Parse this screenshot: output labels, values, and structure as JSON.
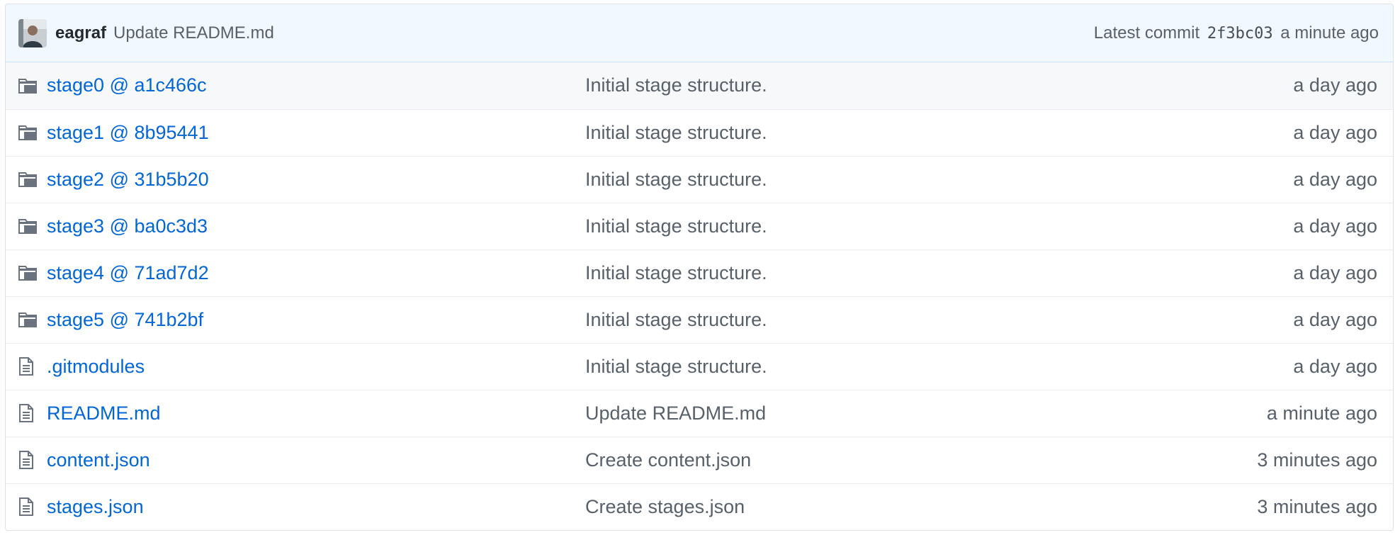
{
  "latest_commit": {
    "author": "eagraf",
    "message": "Update README.md",
    "prefix": "Latest commit",
    "sha": "2f3bc03",
    "age": "a minute ago"
  },
  "files": [
    {
      "type": "submodule",
      "icon": "file-submodule-icon",
      "name": "stage0 @ a1c466c",
      "message": "Initial stage structure.",
      "age": "a day ago"
    },
    {
      "type": "submodule",
      "icon": "file-submodule-icon",
      "name": "stage1 @ 8b95441",
      "message": "Initial stage structure.",
      "age": "a day ago"
    },
    {
      "type": "submodule",
      "icon": "file-submodule-icon",
      "name": "stage2 @ 31b5b20",
      "message": "Initial stage structure.",
      "age": "a day ago"
    },
    {
      "type": "submodule",
      "icon": "file-submodule-icon",
      "name": "stage3 @ ba0c3d3",
      "message": "Initial stage structure.",
      "age": "a day ago"
    },
    {
      "type": "submodule",
      "icon": "file-submodule-icon",
      "name": "stage4 @ 71ad7d2",
      "message": "Initial stage structure.",
      "age": "a day ago"
    },
    {
      "type": "submodule",
      "icon": "file-submodule-icon",
      "name": "stage5 @ 741b2bf",
      "message": "Initial stage structure.",
      "age": "a day ago"
    },
    {
      "type": "file",
      "icon": "file-text-icon",
      "name": ".gitmodules",
      "message": "Initial stage structure.",
      "age": "a day ago"
    },
    {
      "type": "file",
      "icon": "file-text-icon",
      "name": "README.md",
      "message": "Update README.md",
      "age": "a minute ago"
    },
    {
      "type": "file",
      "icon": "file-text-icon",
      "name": "content.json",
      "message": "Create content.json",
      "age": "3 minutes ago"
    },
    {
      "type": "file",
      "icon": "file-text-icon",
      "name": "stages.json",
      "message": "Create stages.json",
      "age": "3 minutes ago"
    }
  ],
  "colors": {
    "link": "#0366d6",
    "muted": "#586069",
    "icon": "#6a737d",
    "tease_bg": "#f1f8ff",
    "border": "#dfe2e5"
  }
}
